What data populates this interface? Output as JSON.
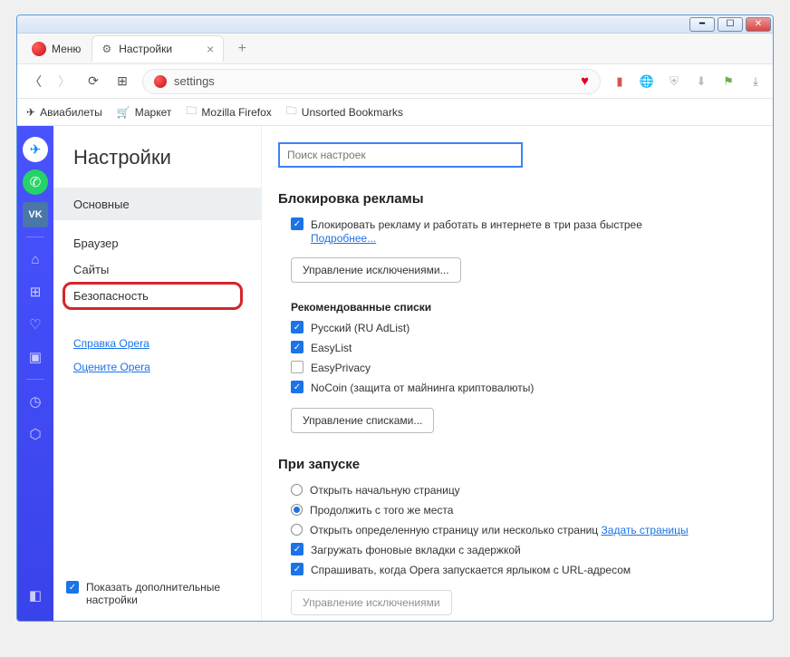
{
  "window": {
    "menu_label": "Меню"
  },
  "tab": {
    "title": "Настройки"
  },
  "address": {
    "value": "settings"
  },
  "bookmarks": {
    "avia": "Авиабилеты",
    "market": "Маркет",
    "firefox": "Mozilla Firefox",
    "unsorted": "Unsorted Bookmarks"
  },
  "settings": {
    "title": "Настройки",
    "nav": {
      "main": "Основные",
      "browser": "Браузер",
      "sites": "Сайты",
      "security": "Безопасность",
      "help": "Справка Opera",
      "rate": "Оцените Opera"
    },
    "advanced": "Показать дополнительные настройки",
    "search_placeholder": "Поиск настроек"
  },
  "adblock": {
    "heading": "Блокировка рекламы",
    "block_label": "Блокировать рекламу и работать в интернете в три раза быстрее",
    "more": "Подробнее...",
    "manage_ex": "Управление исключениями...",
    "lists_heading": "Рекомендованные списки",
    "list_ru": "Русский (RU AdList)",
    "list_easy": "EasyList",
    "list_privacy": "EasyPrivacy",
    "list_nocoin": "NoCoin (защита от майнинга криптовалюты)",
    "manage_lists": "Управление списками..."
  },
  "startup": {
    "heading": "При запуске",
    "r1": "Открыть начальную страницу",
    "r2": "Продолжить с того же места",
    "r3": "Открыть определенную страницу или несколько страниц",
    "r3_link": "Задать страницы",
    "c1": "Загружать фоновые вкладки с задержкой",
    "c2": "Спрашивать, когда Opera запускается ярлыком с URL-адресом",
    "manage_ex2": "Управление исключениями"
  }
}
